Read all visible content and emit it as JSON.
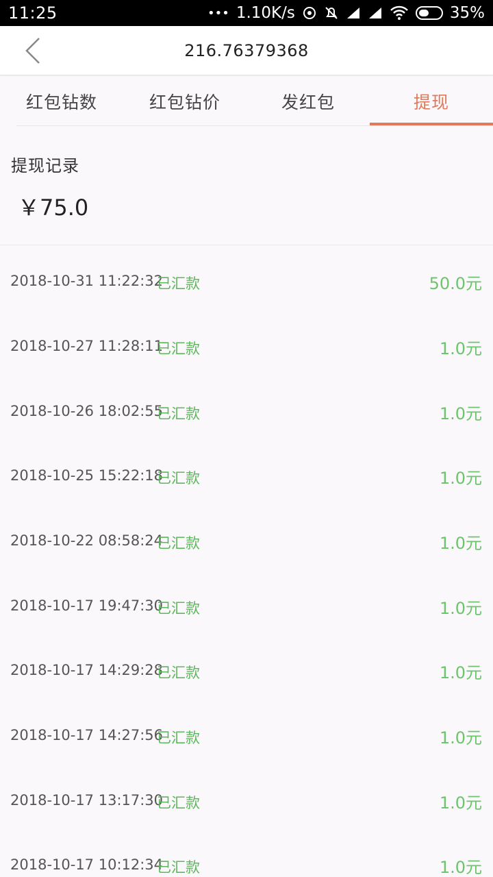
{
  "status_bar": {
    "time": "11:25",
    "dots": "•••",
    "speed": "1.10K/s",
    "battery": "35%"
  },
  "header": {
    "title": "216.76379368"
  },
  "tabs": [
    {
      "label": "红包钻数",
      "active": false
    },
    {
      "label": "红包钻价",
      "active": false
    },
    {
      "label": "发红包",
      "active": false
    },
    {
      "label": "提现",
      "active": true
    }
  ],
  "summary": {
    "title": "提现记录",
    "amount": "￥75.0"
  },
  "records": [
    {
      "date": "2018-10-31 11:22:32",
      "status": "已汇款",
      "amount": "50.0元"
    },
    {
      "date": "2018-10-27 11:28:11",
      "status": "已汇款",
      "amount": "1.0元"
    },
    {
      "date": "2018-10-26 18:02:55",
      "status": "已汇款",
      "amount": "1.0元"
    },
    {
      "date": "2018-10-25 15:22:18",
      "status": "已汇款",
      "amount": "1.0元"
    },
    {
      "date": "2018-10-22 08:58:24",
      "status": "已汇款",
      "amount": "1.0元"
    },
    {
      "date": "2018-10-17 19:47:30",
      "status": "已汇款",
      "amount": "1.0元"
    },
    {
      "date": "2018-10-17 14:29:28",
      "status": "已汇款",
      "amount": "1.0元"
    },
    {
      "date": "2018-10-17 14:27:56",
      "status": "已汇款",
      "amount": "1.0元"
    },
    {
      "date": "2018-10-17 13:17:30",
      "status": "已汇款",
      "amount": "1.0元"
    },
    {
      "date": "2018-10-17 10:12:34",
      "status": "已汇款",
      "amount": "1.0元"
    }
  ],
  "colors": {
    "accent": "#e07a5a",
    "success": "#5cb85c"
  }
}
